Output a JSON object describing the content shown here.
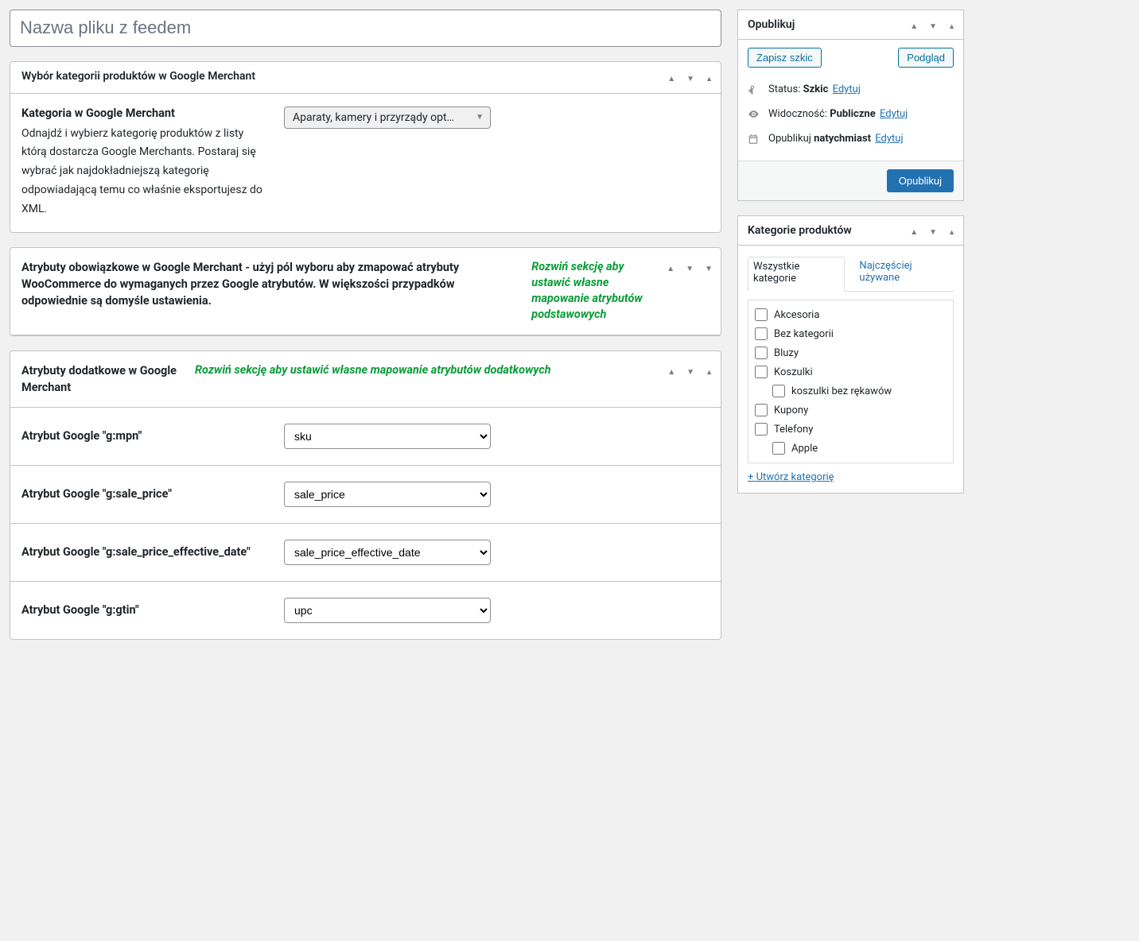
{
  "title_placeholder": "Nazwa pliku z feedem",
  "panels": {
    "category": {
      "title": "Wybór kategorii produktów w Google Merchant",
      "label": "Kategoria w Google Merchant",
      "desc": "Odnajdź i wybierz kategorię produktów z listy którą dostarcza Google Merchants. Postaraj się wybrać jak najdokładniejszą kategorię odpowiadającą temu co właśnie eksportujesz do XML.",
      "selected": "Aparaty, kamery i przyrządy opt…"
    },
    "mandatory": {
      "title": "Atrybuty obowiązkowe w Google Merchant - użyj pól wyboru aby zmapować atrybuty WooCommerce do wymaganych przez Google atrybutów. W większości przypadków odpowiednie są domyśle ustawienia.",
      "hint": "Rozwiń sekcję aby ustawić własne mapowanie atrybutów podstawowych"
    },
    "additional": {
      "title": "Atrybuty dodatkowe w Google Merchant",
      "hint": "Rozwiń sekcję aby ustawić własne mapowanie atrybutów dodatkowych",
      "rows": [
        {
          "label": "Atrybut Google \"g:mpn\"",
          "value": "sku"
        },
        {
          "label": "Atrybut Google \"g:sale_price\"",
          "value": "sale_price"
        },
        {
          "label": "Atrybut Google \"g:sale_price_effective_date\"",
          "value": "sale_price_effective_date"
        },
        {
          "label": "Atrybut Google \"g:gtin\"",
          "value": "upc"
        }
      ]
    }
  },
  "publish": {
    "title": "Opublikuj",
    "save_draft": "Zapisz szkic",
    "preview": "Podgląd",
    "status_label": "Status:",
    "status_value": "Szkic",
    "edit": "Edytuj",
    "visibility_label": "Widoczność:",
    "visibility_value": "Publiczne",
    "schedule_label": "Opublikuj",
    "schedule_value": "natychmiast",
    "publish_btn": "Opublikuj"
  },
  "categories": {
    "title": "Kategorie produktów",
    "tab_all": "Wszystkie kategorie",
    "tab_popular": "Najczęściej używane",
    "items": [
      {
        "label": "Akcesoria",
        "child": false
      },
      {
        "label": "Bez kategorii",
        "child": false
      },
      {
        "label": "Bluzy",
        "child": false
      },
      {
        "label": "Koszulki",
        "child": false
      },
      {
        "label": "koszulki bez rękawów",
        "child": true
      },
      {
        "label": "Kupony",
        "child": false
      },
      {
        "label": "Telefony",
        "child": false
      },
      {
        "label": "Apple",
        "child": true
      }
    ],
    "add_new": "+ Utwórz kategorię"
  }
}
